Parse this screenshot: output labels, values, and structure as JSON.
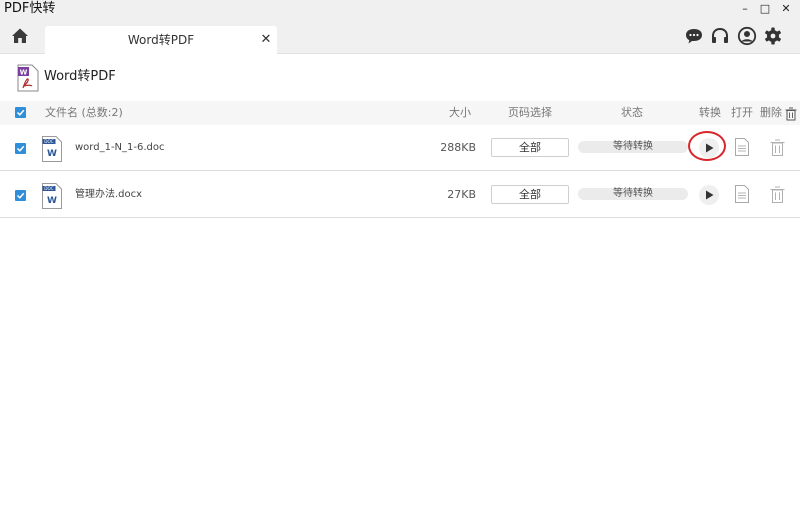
{
  "app": {
    "title": "PDF快转"
  },
  "window_controls": {
    "minimize": "–",
    "maximize": "□",
    "close": "✕"
  },
  "tabs": [
    {
      "label": "Word转PDF",
      "close": "✕"
    }
  ],
  "header": {
    "title": "Word转PDF"
  },
  "table": {
    "columns": {
      "filename": "文件名 (总数:2)",
      "size": "大小",
      "page_select": "页码选择",
      "status": "状态",
      "convert": "转换",
      "open": "打开",
      "delete": "删除"
    },
    "rows": [
      {
        "name": "word_1-N_1-6.doc",
        "size": "288KB",
        "pages": "全部",
        "status": "等待转换",
        "checked": true
      },
      {
        "name": "管理办法.docx",
        "size": "27KB",
        "pages": "全部",
        "status": "等待转换",
        "checked": true
      }
    ]
  },
  "icons": {
    "home": "home-icon",
    "chat": "chat-bubble-icon",
    "support": "headphones-icon",
    "user": "user-icon",
    "settings": "gear-icon",
    "word_doc": "word-file-icon",
    "play": "play-icon",
    "open": "document-icon",
    "delete": "trash-icon"
  },
  "colors": {
    "accent": "#2f8fd8",
    "word_blue": "#2b5797",
    "highlight": "#d8262b",
    "pdf_purple": "#7b3fa0"
  }
}
